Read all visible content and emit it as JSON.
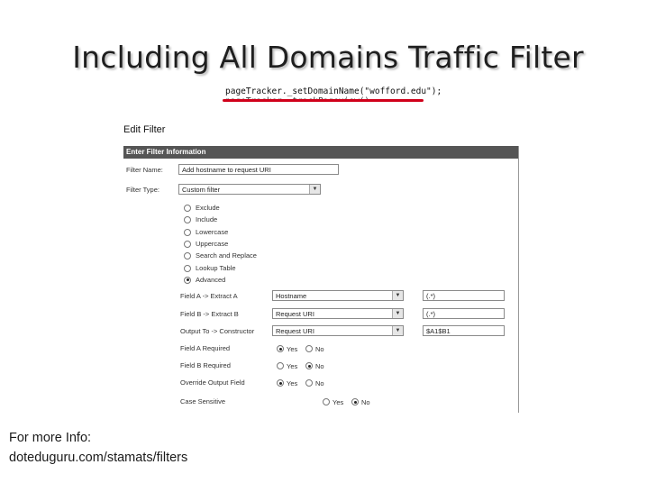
{
  "slide": {
    "title": "Including All Domains Traffic Filter",
    "code_line1": "pageTracker._setDomainName(\"wofford.edu\");",
    "code_line2": "pageTracker._trackPageview();",
    "footer_line1": "For more Info:",
    "footer_line2": "doteduguru.com/stamats/filters",
    "accent_color": "#d0001a"
  },
  "filter": {
    "heading": "Edit Filter",
    "section": "Enter Filter Information",
    "name_label": "Filter Name:",
    "name_value": "Add hostname to request URI",
    "type_label": "Filter Type:",
    "type_value": "Custom filter",
    "type_options": [
      {
        "label": "Exclude",
        "selected": false
      },
      {
        "label": "Include",
        "selected": false
      },
      {
        "label": "Lowercase",
        "selected": false
      },
      {
        "label": "Uppercase",
        "selected": false
      },
      {
        "label": "Search and Replace",
        "selected": false
      },
      {
        "label": "Lookup Table",
        "selected": false
      },
      {
        "label": "Advanced",
        "selected": true
      }
    ],
    "field_a": {
      "label": "Field A -> Extract A",
      "select": "Hostname",
      "value": "(.*)"
    },
    "field_b": {
      "label": "Field B -> Extract B",
      "select": "Request URI",
      "value": "(.*)"
    },
    "output": {
      "label": "Output To -> Constructor",
      "select": "Request URI",
      "value": "$A1$B1"
    },
    "field_a_required": {
      "label": "Field A Required",
      "yes": "Yes",
      "no": "No",
      "selected": "Yes"
    },
    "field_b_required": {
      "label": "Field B Required",
      "yes": "Yes",
      "no": "No",
      "selected": "No"
    },
    "override_output": {
      "label": "Override Output Field",
      "yes": "Yes",
      "no": "No",
      "selected": "Yes"
    },
    "case_sensitive": {
      "label": "Case Sensitive",
      "yes": "Yes",
      "no": "No",
      "selected": "No"
    }
  }
}
